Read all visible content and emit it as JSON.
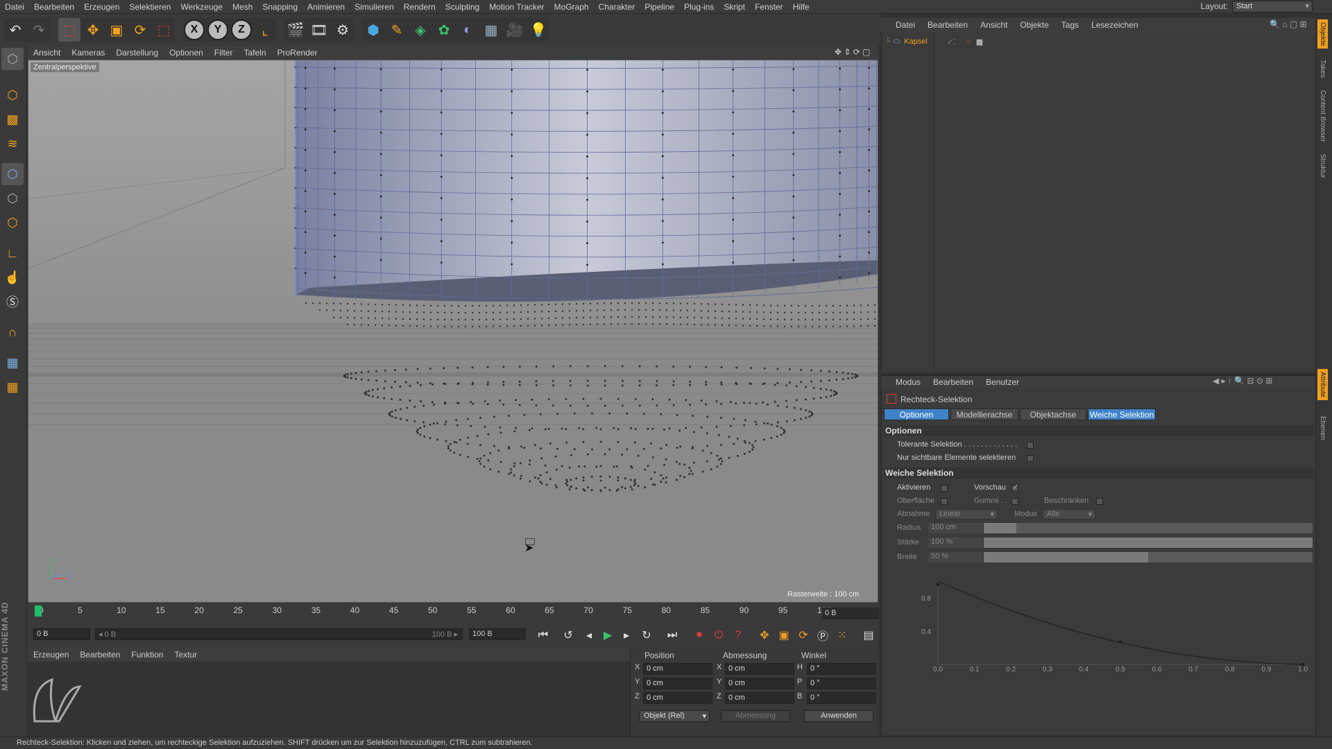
{
  "menubar": {
    "items": [
      "Datei",
      "Bearbeiten",
      "Erzeugen",
      "Selektieren",
      "Werkzeuge",
      "Mesh",
      "Snapping",
      "Animieren",
      "Simulieren",
      "Rendern",
      "Sculpting",
      "Motion Tracker",
      "MoGraph",
      "Charakter",
      "Pipeline",
      "Plug-ins",
      "Skript",
      "Fenster",
      "Hilfe"
    ],
    "layout_label": "Layout:",
    "layout_value": "Start"
  },
  "toolbar": {
    "axis_x": "X",
    "axis_y": "Y",
    "axis_z": "Z"
  },
  "viewport": {
    "menu": [
      "Ansicht",
      "Kameras",
      "Darstellung",
      "Optionen",
      "Filter",
      "Tafeln",
      "ProRender"
    ],
    "label": "Zentralperspektive",
    "raster": "Rasterweite : 100 cm",
    "axis_y": "Y",
    "axis_z": "Z"
  },
  "timeline": {
    "ticks": [
      "0",
      "5",
      "10",
      "15",
      "20",
      "25",
      "30",
      "35",
      "40",
      "45",
      "50",
      "55",
      "60",
      "65",
      "70",
      "75",
      "80",
      "85",
      "90",
      "95",
      "100"
    ],
    "frame_end": "0 B",
    "current": "0 B",
    "range_start": "◂ 0 B",
    "range_end": "100 B ▸",
    "end_field": "100 B"
  },
  "material": {
    "menu": [
      "Erzeugen",
      "Bearbeiten",
      "Funktion",
      "Textur"
    ]
  },
  "coords": {
    "h_position": "Position",
    "h_size": "Abmessung",
    "h_angle": "Winkel",
    "rows": [
      {
        "axis": "X",
        "pos": "0 cm",
        "sax": "X",
        "size": "0 cm",
        "aax": "H",
        "angle": "0 °"
      },
      {
        "axis": "Y",
        "pos": "0 cm",
        "sax": "Y",
        "size": "0 cm",
        "aax": "P",
        "angle": "0 °"
      },
      {
        "axis": "Z",
        "pos": "0 cm",
        "sax": "Z",
        "size": "0 cm",
        "aax": "B",
        "angle": "0 °"
      }
    ],
    "mode": "Objekt (Rel)",
    "size_mode": "Abmessung",
    "apply": "Anwenden"
  },
  "logo": {
    "text": "MAXON CINEMA 4D"
  },
  "status": "Rechteck-Selektion: Klicken und ziehen, um rechteckige Selektion aufzuziehen. SHIFT drücken um zur Selektion hinzuzufügen, CTRL zum subtrahieren.",
  "objects": {
    "menu": [
      "Datei",
      "Bearbeiten",
      "Ansicht",
      "Objekte",
      "Tags",
      "Lesezeichen"
    ],
    "item": "Kapsel"
  },
  "attributes": {
    "menu": [
      "Modus",
      "Bearbeiten",
      "Benutzer"
    ],
    "title": "Rechteck-Selektion",
    "tabs": [
      "Optionen",
      "Modellierachse",
      "Objektachse",
      "Weiche Selektion"
    ],
    "section_options": "Optionen",
    "tolerant": "Tolerante Selektion . . . . . . . . . . . . .",
    "visible_only": "Nur sichtbare Elemente selektieren",
    "section_soft": "Weiche Selektion",
    "activate": "Aktivieren",
    "preview": "Vorschau",
    "surface": "Oberfläche",
    "rubber": "Gummi . .",
    "restrict": "Beschränken",
    "falloff": "Abnahme",
    "falloff_value": "Linear",
    "mode": "Modus",
    "mode_value": "Alle",
    "radius": "Radius",
    "radius_value": "100 cm",
    "radius_fraction": 0.1,
    "strength": "Stärke",
    "strength_value": "100 %",
    "strength_fraction": 1.0,
    "width": "Breite",
    "width_value": "50 %",
    "width_fraction": 0.5,
    "graph_y": [
      "0.8",
      "0.4"
    ],
    "graph_x": [
      "0.0",
      "0.1",
      "0.2",
      "0.3",
      "0.4",
      "0.5",
      "0.6",
      "0.7",
      "0.8",
      "0.9",
      "1.0"
    ]
  },
  "righttabs": [
    "Objekte",
    "Takes",
    "Content Browser",
    "Struktur",
    "Attribute",
    "Ebenen"
  ]
}
